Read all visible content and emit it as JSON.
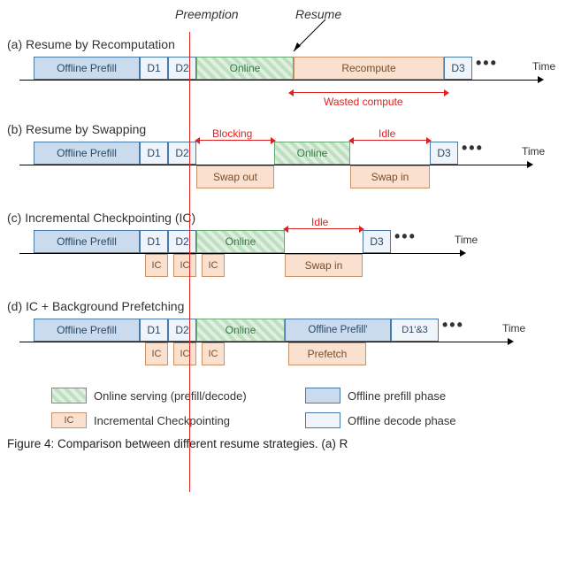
{
  "header": {
    "preemption": "Preemption",
    "resume": "Resume"
  },
  "rows": {
    "a": {
      "title": "(a) Resume by Recomputation"
    },
    "b": {
      "title": "(b) Resume by Swapping"
    },
    "c": {
      "title": "(c) Incremental Checkpointing (IC)"
    },
    "d": {
      "title": "(d) IC + Background Prefetching"
    }
  },
  "labels": {
    "offline_prefill": "Offline Prefill",
    "offline_prefill2": "Offline Prefill'",
    "d1": "D1",
    "d2": "D2",
    "d3": "D3",
    "d1_3": "D1'&3",
    "online": "Online",
    "recompute": "Recompute",
    "swap_out": "Swap out",
    "swap_in": "Swap in",
    "ic": "IC",
    "prefetch": "Prefetch",
    "time": "Time"
  },
  "annotations": {
    "wasted": "Wasted compute",
    "blocking": "Blocking",
    "idle": "Idle"
  },
  "legend": {
    "online": "Online serving (prefill/decode)",
    "offline_prefill": "Offline prefill phase",
    "ic": "Incremental Checkpointing",
    "offline_decode": "Offline decode phase"
  },
  "caption": "Figure 4: Comparison between different resume strategies. (a) R",
  "chart_data": {
    "type": "timeline",
    "rows": [
      {
        "id": "a",
        "title": "Resume by Recomputation",
        "main": [
          {
            "label": "Offline Prefill",
            "type": "offline-prefill"
          },
          {
            "label": "D1",
            "type": "offline-decode"
          },
          {
            "label": "D2",
            "type": "offline-decode"
          },
          {
            "label": "Online",
            "type": "online"
          },
          {
            "label": "Recompute",
            "type": "swap"
          },
          {
            "label": "D3",
            "type": "offline-decode"
          }
        ],
        "below": [],
        "annotations": [
          {
            "text": "Wasted compute",
            "span": [
              "Online",
              "Recompute"
            ]
          }
        ]
      },
      {
        "id": "b",
        "title": "Resume by Swapping",
        "main": [
          {
            "label": "Offline Prefill",
            "type": "offline-prefill"
          },
          {
            "label": "D1",
            "type": "offline-decode"
          },
          {
            "label": "D2",
            "type": "offline-decode"
          },
          {
            "gap": true,
            "annotation": "Blocking"
          },
          {
            "label": "Online",
            "type": "online"
          },
          {
            "gap": true,
            "annotation": "Idle"
          },
          {
            "label": "D3",
            "type": "offline-decode"
          }
        ],
        "below": [
          {
            "label": "Swap out",
            "type": "swap",
            "under": "Blocking-gap"
          },
          {
            "label": "Swap in",
            "type": "swap",
            "under": "Idle-gap"
          }
        ]
      },
      {
        "id": "c",
        "title": "Incremental Checkpointing (IC)",
        "main": [
          {
            "label": "Offline Prefill",
            "type": "offline-prefill"
          },
          {
            "label": "D1",
            "type": "offline-decode"
          },
          {
            "label": "D2",
            "type": "offline-decode"
          },
          {
            "label": "Online",
            "type": "online"
          },
          {
            "gap": true,
            "annotation": "Idle"
          },
          {
            "label": "D3",
            "type": "offline-decode"
          }
        ],
        "below": [
          {
            "label": "IC",
            "type": "swap",
            "under": "D1"
          },
          {
            "label": "IC",
            "type": "swap",
            "under": "D2"
          },
          {
            "label": "IC",
            "type": "swap",
            "under": "Online-start"
          },
          {
            "label": "Swap in",
            "type": "swap",
            "under": "Idle-gap"
          }
        ]
      },
      {
        "id": "d",
        "title": "IC + Background Prefetching",
        "main": [
          {
            "label": "Offline Prefill",
            "type": "offline-prefill"
          },
          {
            "label": "D1",
            "type": "offline-decode"
          },
          {
            "label": "D2",
            "type": "offline-decode"
          },
          {
            "label": "Online",
            "type": "online"
          },
          {
            "label": "Offline Prefill'",
            "type": "offline-prefill"
          },
          {
            "label": "D1'&3",
            "type": "offline-decode"
          }
        ],
        "below": [
          {
            "label": "IC",
            "type": "swap",
            "under": "D1"
          },
          {
            "label": "IC",
            "type": "swap",
            "under": "D2"
          },
          {
            "label": "IC",
            "type": "swap",
            "under": "Online-start"
          },
          {
            "label": "Prefetch",
            "type": "swap",
            "under": "Offline Prefill'"
          }
        ]
      }
    ],
    "legend": [
      "Online serving (prefill/decode)",
      "Offline prefill phase",
      "Incremental Checkpointing",
      "Offline decode phase"
    ]
  }
}
